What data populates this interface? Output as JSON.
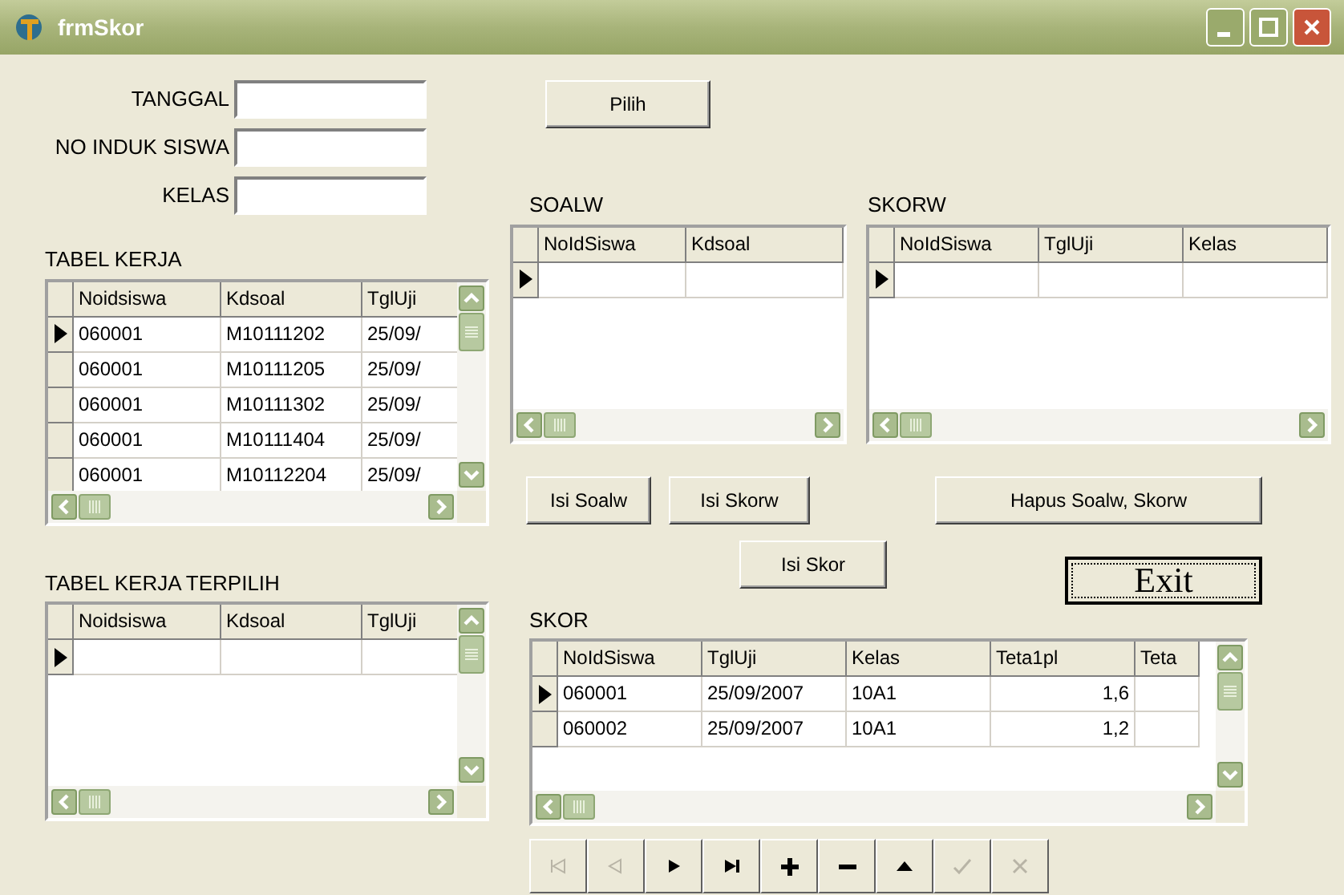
{
  "window": {
    "title": "frmSkor"
  },
  "fields": [
    {
      "label": "TANGGAL"
    },
    {
      "label": "NO INDUK SISWA"
    },
    {
      "label": "KELAS"
    }
  ],
  "pilih_button": "Pilih",
  "tabel_kerja": {
    "label": "TABEL KERJA",
    "columns": [
      "Noidsiswa",
      "Kdsoal",
      "TglUji"
    ],
    "vertical_scrollbar": true,
    "rows": [
      {
        "selected": true,
        "cells": [
          "060001",
          "M10111202",
          "25/09/"
        ]
      },
      {
        "selected": false,
        "cells": [
          "060001",
          "M10111205",
          "25/09/"
        ]
      },
      {
        "selected": false,
        "cells": [
          "060001",
          "M10111302",
          "25/09/"
        ]
      },
      {
        "selected": false,
        "cells": [
          "060001",
          "M10111404",
          "25/09/"
        ]
      },
      {
        "selected": false,
        "cells": [
          "060001",
          "M10112204",
          "25/09/"
        ]
      }
    ]
  },
  "tabel_kerja_terpilih": {
    "label": "TABEL KERJA TERPILIH",
    "columns": [
      "Noidsiswa",
      "Kdsoal",
      "TglUji"
    ],
    "vertical_scrollbar": true,
    "rows": [
      {
        "selected": true,
        "blank": true
      }
    ]
  },
  "soalw": {
    "label": "SOALW",
    "columns": [
      "NoIdSiswa",
      "Kdsoal"
    ],
    "vertical_scrollbar": false,
    "rows": [
      {
        "selected": true,
        "blank": true
      }
    ]
  },
  "skorw": {
    "label": "SKORW",
    "columns": [
      "NoIdSiswa",
      "TglUji",
      "Kelas"
    ],
    "vertical_scrollbar": false,
    "rows": [
      {
        "selected": true,
        "blank": true
      }
    ]
  },
  "buttons": {
    "isi_soalw": "Isi Soalw",
    "isi_skorw": "Isi Skorw",
    "hapus": "Hapus Soalw, Skorw",
    "isi_skor": "Isi Skor",
    "exit": "Exit",
    "exit_focused": true
  },
  "skor": {
    "label": "SKOR",
    "columns": [
      "NoIdSiswa",
      "TglUji",
      "Kelas",
      "Teta1pl",
      "Teta"
    ],
    "vertical_scrollbar": true,
    "rows": [
      {
        "selected": true,
        "cells": [
          "060001",
          "25/09/2007",
          "10A1",
          "1,6"
        ]
      },
      {
        "selected": false,
        "cells": [
          "060002",
          "25/09/2007",
          "10A1",
          "1,2"
        ]
      }
    ]
  },
  "navigator": [
    {
      "kind": "first",
      "disabled": true
    },
    {
      "kind": "prior",
      "disabled": true
    },
    {
      "kind": "next",
      "disabled": false
    },
    {
      "kind": "last",
      "disabled": false
    },
    {
      "kind": "insert",
      "disabled": false
    },
    {
      "kind": "delete",
      "disabled": false
    },
    {
      "kind": "edit",
      "disabled": false
    },
    {
      "kind": "post",
      "disabled": true
    },
    {
      "kind": "cancel",
      "disabled": true
    }
  ]
}
